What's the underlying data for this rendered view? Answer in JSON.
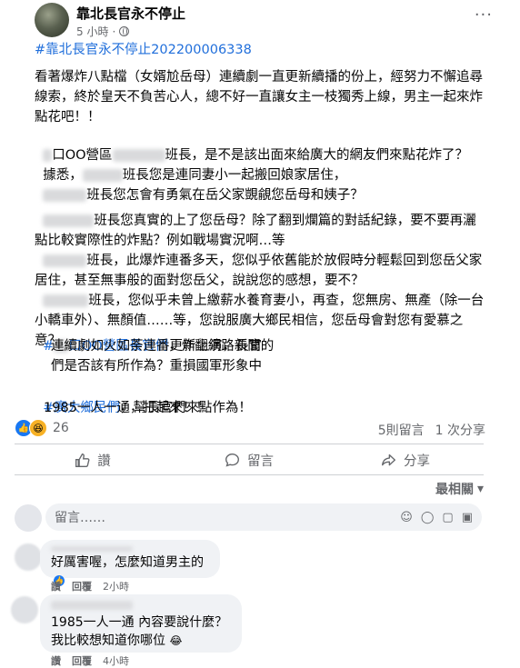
{
  "header": {
    "page_name": "靠北長官永不停止",
    "time": "5 小時",
    "dot": "·",
    "more": "···"
  },
  "post": {
    "hashtag_top": "#靠北長官永不停止202200006338",
    "p1": "看著爆炸八點檔（女婿尬岳母）連續劇一直更新續播的份上，經努力不懈追尋線索，終於皇天不負苦心人，總不好一直讓女主一枝獨秀上線，男主一起來炸點花吧！！",
    "p2a": "口OO營區",
    "p2b": "班長，是不是該出面來給廣大的網友們來點花炸了？",
    "p3a": "據悉，",
    "p3b": "班長您是連同妻小一起搬回娘家居住，",
    "p4": "班長您怎會有勇氣在岳父家覬覦您岳母和姨子？",
    "p5": "班長您真實的上了您岳母？除了翻到爛篇的對話紀錄，要不要再灑點比較實際性的炸點？例如戰場實況啊…等",
    "p6": "班長，此爆炸連番多天，您似乎依舊能於放假時分輕鬆回到您岳父家居住，甚至無事般的面對您岳父，說說您的感想，要不？",
    "p7": "班長，您似乎未曾上繳薪水養育妻小，再查，您無房、無產（除一台小轎車外）、無顏值……等，您說服廣大鄉民相信，您岳母會對您有愛慕之意？",
    "hashtag_officers": "#",
    "p8a": "口OO營區長官們",
    "p8b": "，炸翻網路新聞的",
    "p8c": "連續劇如火如荼連番更新上演，長官",
    "p8d": "們是否該有所作為？重損國軍形象中",
    "hashtag_villagers": "#廣大鄉民們",
    "p9a": "，幫長官們來點作為！",
    "p9b": "1985一人一通，打起來！！"
  },
  "reactions": {
    "count": "26",
    "comments": "5則留言",
    "shares": "1 次分享"
  },
  "actions": {
    "like": "讚",
    "comment": "留言",
    "share": "分享"
  },
  "comments_section": {
    "sort_label": "最相關",
    "input_placeholder": "留言……",
    "items": [
      {
        "text": "好厲害喔，怎麼知道男主的",
        "like": "讚",
        "reply": "回覆",
        "time": "2小時"
      },
      {
        "text1": "1985一人一通 內容要說什麼？",
        "text2": "我比較想知道你哪位",
        "like": "讚",
        "reply": "回覆",
        "time": "4小時"
      }
    ]
  }
}
